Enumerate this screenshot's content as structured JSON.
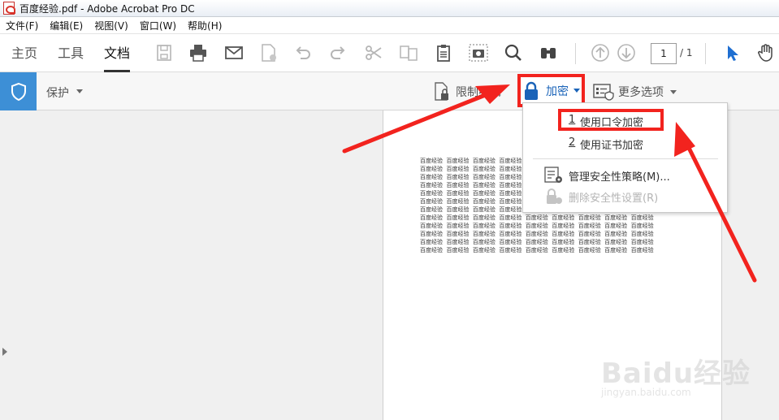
{
  "window": {
    "title": "百度经验.pdf - Adobe Acrobat Pro DC"
  },
  "menubar": [
    "文件(F)",
    "编辑(E)",
    "视图(V)",
    "窗口(W)",
    "帮助(H)"
  ],
  "toolbar": {
    "tabs": [
      "主页",
      "工具",
      "文档"
    ],
    "active_tab": "文档",
    "page_current": "1",
    "page_total": "/ 1",
    "icons": [
      "save-icon",
      "print-icon",
      "email-icon",
      "pdf-sign-icon",
      "undo-icon",
      "redo-icon",
      "scissors-icon",
      "compare-icon",
      "clipboard-icon",
      "camera-icon",
      "search-icon",
      "binoculars-icon",
      "page-up-icon",
      "page-down-icon",
      "pointer-icon",
      "hand-icon"
    ]
  },
  "protect_toolbar": {
    "label": "保护",
    "restrict_edit": "限制编辑",
    "encrypt": "加密",
    "more_options": "更多选项"
  },
  "dropdown": {
    "items": [
      {
        "num": "1",
        "label": "使用口令加密",
        "disabled": false
      },
      {
        "num": "2",
        "label": "使用证书加密",
        "disabled": false
      },
      {
        "label": "管理安全性策略(M)...",
        "disabled": false
      },
      {
        "label": "删除安全性设置(R)",
        "disabled": true
      }
    ]
  },
  "document": {
    "cell_text": "百度经验",
    "lines": [
      "百度经验  百度经验  百度经验  百度经验",
      "百度经验  百度经验  百度经验  百度经验",
      "百度经验  百度经验  百度经验  百度经验",
      "百度经验  百度经验  百度经验  百度经验",
      "百度经验  百度经验  百度经验  百度经验",
      "百度经验  百度经验  百度经验  百度经验",
      "百度经验  百度经验  百度经验  百度经验",
      "百度经验  百度经验  百度经验  百度经验  百度经验  百度经验  百度经验  百度经验  百度经验",
      "百度经验  百度经验  百度经验  百度经验  百度经验  百度经验  百度经验  百度经验  百度经验",
      "百度经验  百度经验  百度经验  百度经验  百度经验  百度经验  百度经验  百度经验  百度经验",
      "百度经验  百度经验  百度经验  百度经验  百度经验  百度经验  百度经验  百度经验  百度经验",
      "百度经验  百度经验  百度经验  百度经验  百度经验  百度经验  百度经验  百度经验  百度经验"
    ]
  },
  "watermark": {
    "brand": "Baidu经验",
    "url": "jingyan.baidu.com"
  },
  "colors": {
    "accent_blue": "#3d8fd6",
    "highlight_red": "#f2231e",
    "link_blue": "#1a63b8"
  }
}
